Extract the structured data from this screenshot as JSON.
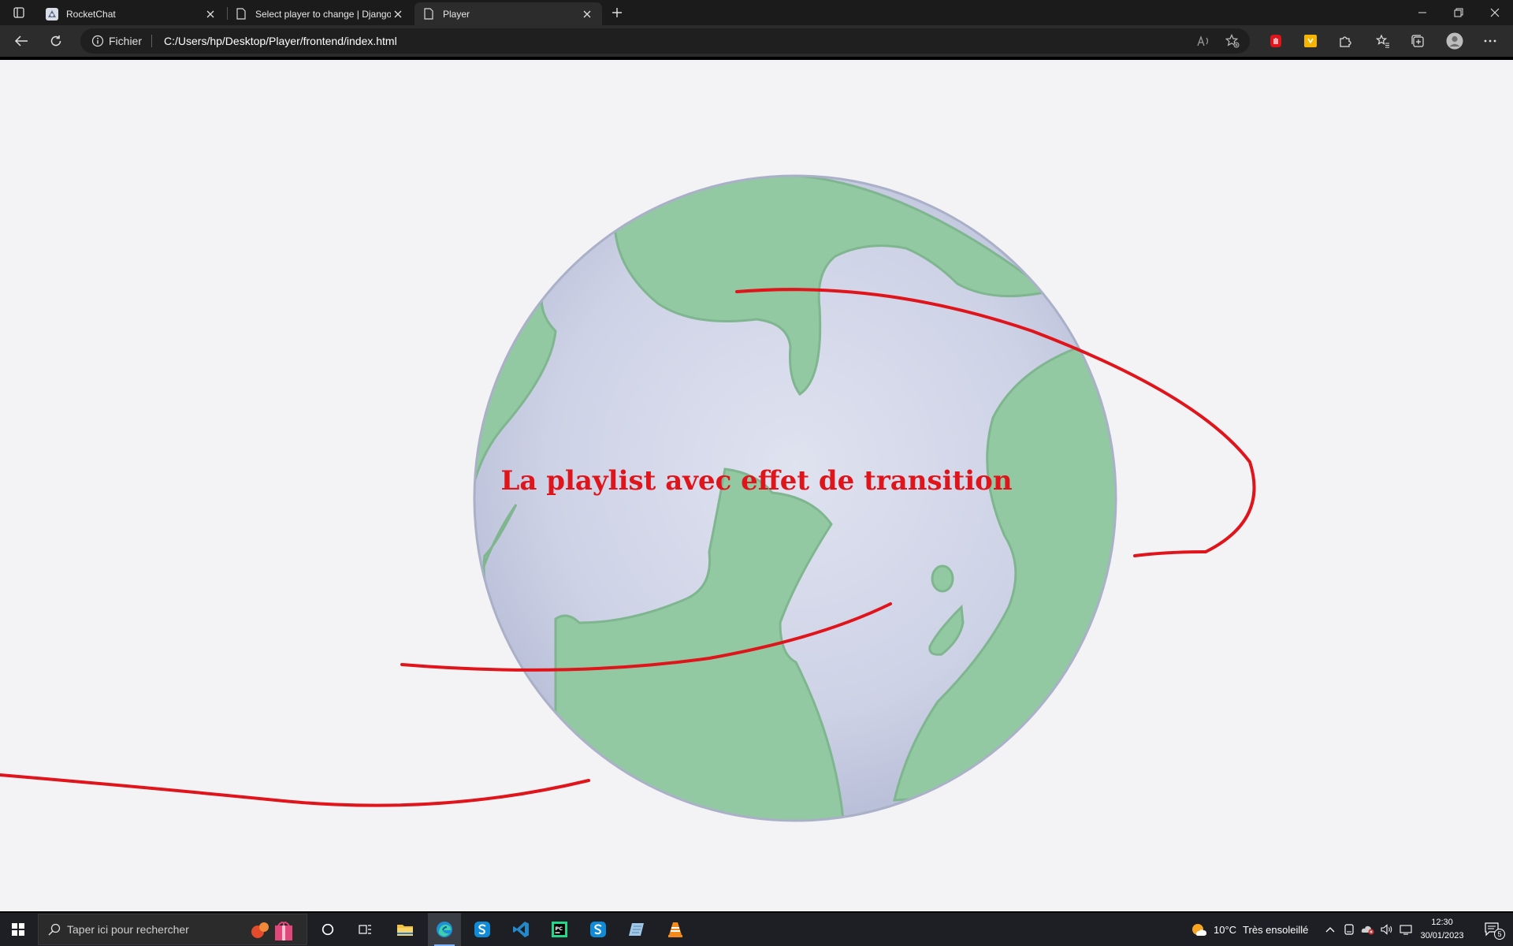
{
  "browser": {
    "tabs": [
      {
        "title": "RocketChat",
        "active": false
      },
      {
        "title": "Select player to change | Django",
        "active": false
      },
      {
        "title": "Player",
        "active": true
      }
    ],
    "address": {
      "info_label": "Fichier",
      "url": "C:/Users/hp/Desktop/Player/frontend/index.html"
    },
    "toolbar_icons": [
      "read-aloud-icon",
      "favorite-add-icon",
      "extension-red-icon",
      "extension-yellow-icon",
      "extensions-icon",
      "favorites-icon",
      "collections-icon",
      "profile-icon",
      "more-icon"
    ]
  },
  "page": {
    "heading": "La playlist avec effet de transition",
    "accent_color": "#e0141b",
    "background_color": "#f3f2f4"
  },
  "taskbar": {
    "search_placeholder": "Taper ici pour rechercher",
    "apps": [
      "cortana-icon",
      "task-view-icon",
      "file-explorer-icon",
      "edge-icon",
      "skype-icon",
      "vscode-icon",
      "pycharm-icon",
      "skype-icon-2",
      "notepad-icon",
      "vlc-icon"
    ],
    "weather": {
      "temp": "10°C",
      "desc": "Très ensoleillé"
    },
    "clock": {
      "time": "12:30",
      "date": "30/01/2023"
    },
    "notifications_count": "5"
  }
}
